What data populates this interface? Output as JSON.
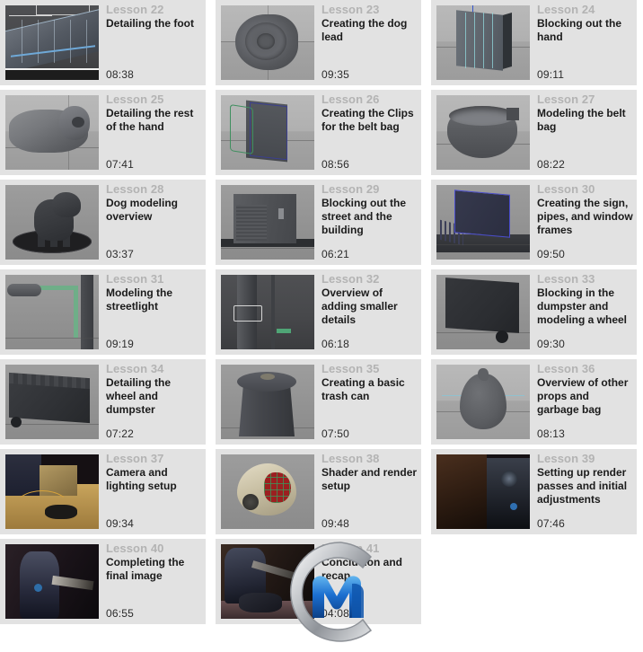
{
  "page": {
    "background_color": "#ffffff",
    "card_background_color": "#e2e2e2",
    "lesson_label_color": "#b3b3b3",
    "title_color": "#1b1b1b",
    "duration_color": "#2b2b2b",
    "columns": 3,
    "rows": 7
  },
  "watermark": {
    "name": "cgmodel-logo-watermark",
    "ring_color": "#b9bcc0",
    "letter_color": "#1c6fd0"
  },
  "lessons": [
    {
      "label": "Lesson 22",
      "title": "Detailing the foot",
      "duration": "08:38",
      "thumb": "foot-wireframe-thumbnail",
      "scene": "c22",
      "viewport": "vp-dark"
    },
    {
      "label": "Lesson 23",
      "title": "Creating the dog lead",
      "duration": "09:35",
      "thumb": "dog-lead-disc-thumbnail",
      "scene": "c23",
      "viewport": "vp-grey"
    },
    {
      "label": "Lesson 24",
      "title": "Blocking out the hand",
      "duration": "09:11",
      "thumb": "hand-block-wireframe-thumbnail",
      "scene": "c24",
      "viewport": "vp-grey"
    },
    {
      "label": "Lesson 25",
      "title": "Detailing the rest of the hand",
      "duration": "07:41",
      "thumb": "hand-detail-thumbnail",
      "scene": "c25",
      "viewport": "vp-grey"
    },
    {
      "label": "Lesson 26",
      "title": "Creating the Clips for the belt bag",
      "duration": "08:56",
      "thumb": "belt-bag-clips-thumbnail",
      "scene": "c26",
      "viewport": "vp-grey"
    },
    {
      "label": "Lesson 27",
      "title": "Modeling the belt bag",
      "duration": "08:22",
      "thumb": "belt-bag-thumbnail",
      "scene": "c27",
      "viewport": "vp-grey"
    },
    {
      "label": "Lesson 28",
      "title": "Dog modeling overview",
      "duration": "03:37",
      "thumb": "dog-model-thumbnail",
      "scene": "c28",
      "viewport": "vp-midgrey"
    },
    {
      "label": "Lesson 29",
      "title": "Blocking out the street and the building",
      "duration": "06:21",
      "thumb": "street-building-thumbnail",
      "scene": "c29",
      "viewport": "vp-midgrey"
    },
    {
      "label": "Lesson 30",
      "title": "Creating the sign, pipes, and window frames",
      "duration": "09:50",
      "thumb": "sign-pipes-window-thumbnail",
      "scene": "c30",
      "viewport": "vp-midgrey"
    },
    {
      "label": "Lesson 31",
      "title": "Modeling the streetlight",
      "duration": "09:19",
      "thumb": "streetlight-thumbnail",
      "scene": "c31",
      "viewport": "vp-midgrey"
    },
    {
      "label": "Lesson 32",
      "title": "Overview of adding smaller details",
      "duration": "06:18",
      "thumb": "pole-details-thumbnail",
      "scene": "c32",
      "viewport": "vp-dark"
    },
    {
      "label": "Lesson 33",
      "title": "Blocking in the dumpster and modeling a wheel",
      "duration": "09:30",
      "thumb": "dumpster-block-thumbnail",
      "scene": "c33",
      "viewport": "vp-midgrey"
    },
    {
      "label": "Lesson 34",
      "title": "Detailing the wheel and dumpster",
      "duration": "07:22",
      "thumb": "dumpster-detail-thumbnail",
      "scene": "c34",
      "viewport": "vp-midgrey"
    },
    {
      "label": "Lesson 35",
      "title": "Creating a basic trash can",
      "duration": "07:50",
      "thumb": "trash-can-thumbnail",
      "scene": "c35",
      "viewport": "vp-midgrey"
    },
    {
      "label": "Lesson 36",
      "title": "Overview of other props and garbage bag",
      "duration": "08:13",
      "thumb": "garbage-bag-thumbnail",
      "scene": "c36",
      "viewport": "vp-grey"
    },
    {
      "label": "Lesson 37",
      "title": "Camera and lighting setup",
      "duration": "09:34",
      "thumb": "camera-lighting-thumbnail",
      "scene": "c37",
      "viewport": "vp-night"
    },
    {
      "label": "Lesson 38",
      "title": "Shader and render setup",
      "duration": "09:48",
      "thumb": "helmet-shader-thumbnail",
      "scene": "c38",
      "viewport": "vp-midgrey"
    },
    {
      "label": "Lesson 39",
      "title": "Setting up render passes and initial adjustments",
      "duration": "07:46",
      "thumb": "render-passes-thumbnail",
      "scene": "c39",
      "viewport": "vp-night"
    },
    {
      "label": "Lesson 40",
      "title": "Completing the final image",
      "duration": "06:55",
      "thumb": "final-image-thumbnail",
      "scene": "c40",
      "viewport": "vp-night"
    },
    {
      "label": "Lesson 41",
      "title": "Conclusion and recap",
      "duration": "04:08",
      "thumb": "conclusion-thumbnail",
      "scene": "c41",
      "viewport": "vp-night"
    }
  ]
}
